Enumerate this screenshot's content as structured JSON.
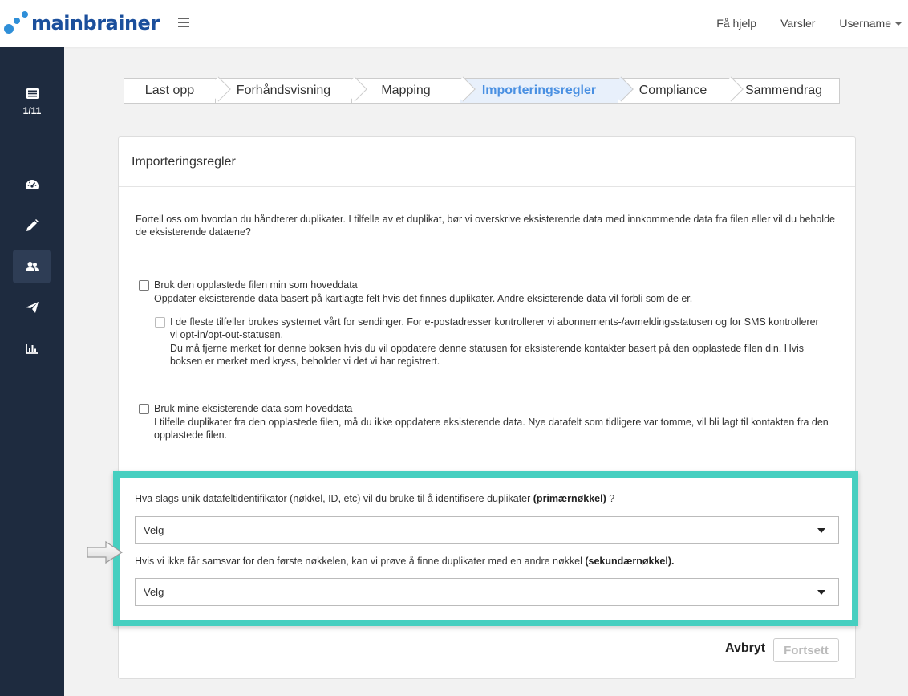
{
  "app": {
    "logo_text": "mainbrainer",
    "brand_color": "#1b4f9c"
  },
  "topnav": {
    "help": "Få hjelp",
    "alerts": "Varsler",
    "username": "Username"
  },
  "sidebar": {
    "counter": "1/11",
    "items": [
      {
        "icon": "dashboard-icon"
      },
      {
        "icon": "pencil-icon"
      },
      {
        "icon": "users-icon",
        "active": true
      },
      {
        "icon": "paper-plane-icon"
      },
      {
        "icon": "bar-chart-icon"
      }
    ]
  },
  "steps": [
    {
      "label": "Last opp"
    },
    {
      "label": "Forhåndsvisning"
    },
    {
      "label": "Mapping"
    },
    {
      "label": "Importeringsregler",
      "active": true
    },
    {
      "label": "Compliance"
    },
    {
      "label": "Sammendrag"
    }
  ],
  "card": {
    "title": "Importeringsregler",
    "intro": "Fortell oss om hvordan du håndterer duplikater. I tilfelle av et duplikat, bør vi overskrive eksisterende data med innkommende data fra filen eller vil du beholde de eksisterende dataene?",
    "option1": {
      "label": "Bruk den opplastede filen min som hoveddata",
      "desc": "Oppdater eksisterende data basert på kartlagte felt hvis det finnes duplikater. Andre eksisterende data vil forbli som de er."
    },
    "sub_option": {
      "label": "I de fleste tilfeller brukes systemet vårt for sendinger. For e-postadresser kontrollerer vi abonnements-/avmeldingsstatusen og for SMS kontrollerer vi opt-in/opt-out-statusen.",
      "desc": "Du må fjerne merket for denne boksen hvis du vil oppdatere denne statusen for eksisterende kontakter basert på den opplastede filen din. Hvis boksen er merket med kryss, beholder vi det vi har registrert."
    },
    "option2": {
      "label": "Bruk mine eksisterende data som hoveddata",
      "desc": "I tilfelle duplikater fra den opplastede filen, må du ikke oppdatere eksisterende data. Nye datafelt som tidligere var tomme, vil bli lagt til kontakten fra den opplastede filen."
    }
  },
  "keys": {
    "primary_question": "Hva slags unik datafeltidentifikator (nøkkel, ID, etc) vil du bruke til å identifisere duplikater ",
    "primary_bold": "(primærnøkkel)",
    "primary_suffix": " ?",
    "primary_value": "Velg",
    "secondary_question": "Hvis vi ikke får samsvar for den første nøkkelen, kan vi prøve å finne duplikater med en andre nøkkel ",
    "secondary_bold": "(sekundærnøkkel).",
    "secondary_value": "Velg",
    "highlight_color": "#46cfc0"
  },
  "actions": {
    "cancel": "Avbryt",
    "continue": "Fortsett"
  }
}
